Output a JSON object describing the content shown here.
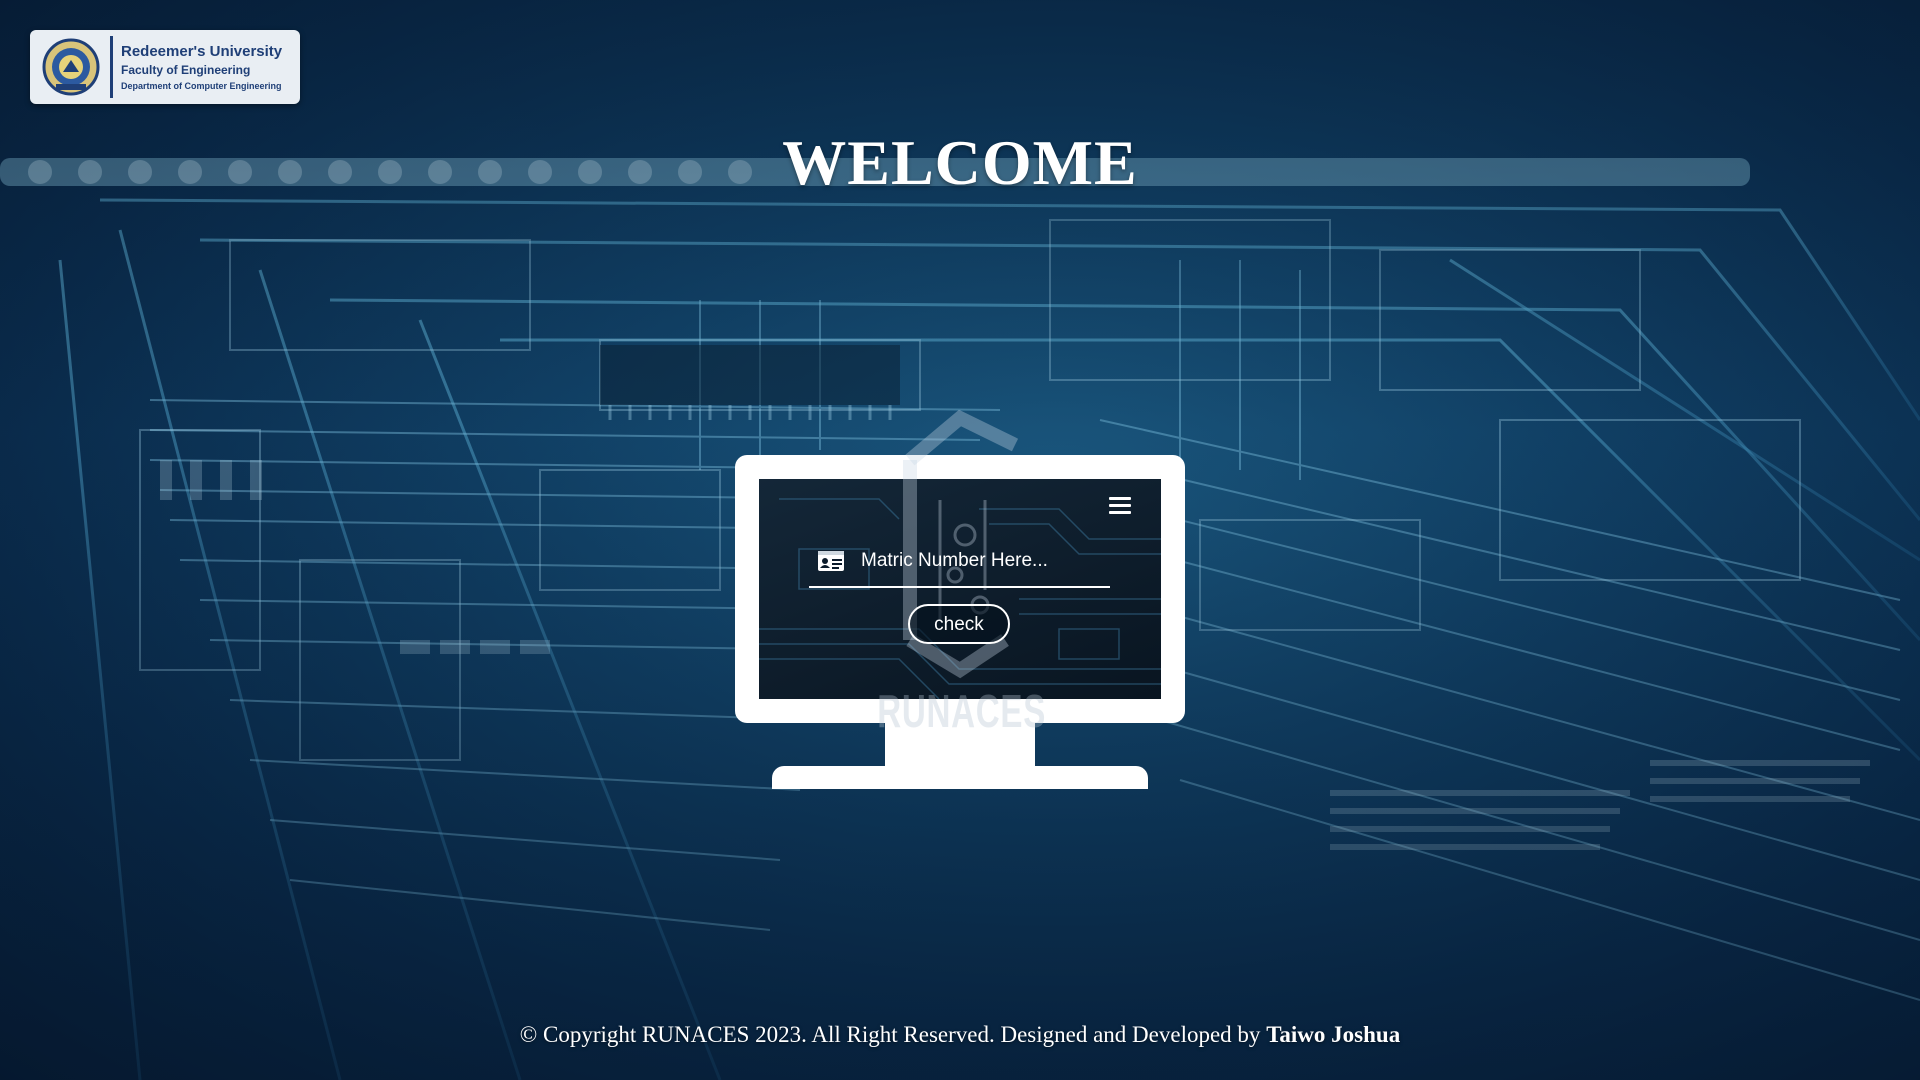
{
  "logo": {
    "university": "Redeemer's University",
    "faculty": "Faculty of Engineering",
    "department": "Department of Computer Engineering",
    "seal_icon": "university-seal-icon"
  },
  "heading": {
    "title": "WELCOME"
  },
  "form": {
    "matric_placeholder": "Matric Number Here...",
    "matric_value": "",
    "check_label": "check",
    "id_icon": "id-card-icon",
    "menu_icon": "hamburger-menu-icon"
  },
  "watermark": {
    "text": "RUNACES"
  },
  "footer": {
    "text": "© Copyright RUNACES 2023. All Right Reserved. Designed and Developed by",
    "author": "Taiwo Joshua"
  },
  "colors": {
    "background_dark": "#0a2c4d",
    "background_mid": "#1b5a82",
    "logo_text": "#1f3f77",
    "logo_card": "#e9eef3",
    "monitor": "#ffffff",
    "screen": "#06121f"
  }
}
